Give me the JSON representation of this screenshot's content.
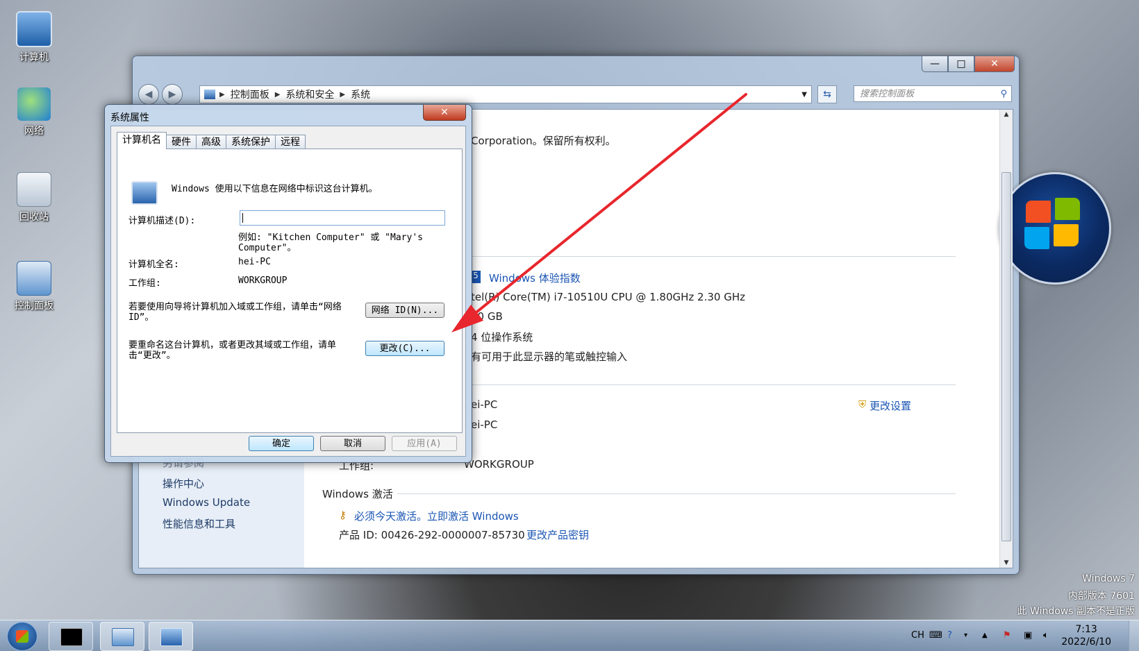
{
  "desktop": {
    "icons": [
      {
        "label": "计算机"
      },
      {
        "label": "网络"
      },
      {
        "label": "回收站"
      },
      {
        "label": "控制面板"
      }
    ]
  },
  "main_window": {
    "buttons": {
      "minimize": "—",
      "maximize": "□",
      "close": "✕"
    },
    "breadcrumb": [
      "控制面板",
      "系统和安全",
      "系统"
    ],
    "search_placeholder": "搜索控制面板",
    "left_pane": {
      "partial_heading": "另请参阅",
      "links": [
        "操作中心",
        "Windows Update",
        "性能信息和工具"
      ]
    },
    "copyright": "Corporation。保留所有权利。",
    "system": {
      "rating_link": "Windows 体验指数",
      "processor": "tel(R) Core(TM) i7-10510U CPU @ 1.80GHz   2.30 GHz",
      "memory": "00 GB",
      "type": "4 位操作系统",
      "pen": "有可用于此显示器的笔或触控输入"
    },
    "computer": {
      "name": "ei-PC",
      "full_name": "ei-PC",
      "workgroup_label": "工作组:",
      "workgroup": "WORKGROUP",
      "change_settings": "更改设置"
    },
    "activation": {
      "heading": "Windows 激活",
      "warning": "必须今天激活。立即激活 Windows",
      "product_id": "产品 ID: 00426-292-0000007-85730",
      "change_key": "更改产品密钥"
    }
  },
  "dialog": {
    "title": "系统属性",
    "close": "✕",
    "tabs": [
      "计算机名",
      "硬件",
      "高级",
      "系统保护",
      "远程"
    ],
    "intro": "Windows 使用以下信息在网络中标识这台计算机。",
    "description_label": "计算机描述(D):",
    "description_value": "",
    "example": "例如: \"Kitchen Computer\" 或 \"Mary's Computer\"。",
    "fullname_label": "计算机全名:",
    "fullname_value": "hei-PC",
    "workgroup_label": "工作组:",
    "workgroup_value": "WORKGROUP",
    "wizard_text": "若要使用向导将计算机加入域或工作组，请单击“网络 ID”。",
    "network_id_button": "网络 ID(N)...",
    "rename_text": "要重命名这台计算机，或者更改其域或工作组，请单击“更改”。",
    "change_button": "更改(C)...",
    "ok": "确定",
    "cancel": "取消",
    "apply": "应用(A)"
  },
  "watermark": {
    "line1": "Windows 7",
    "line2": "内部版本 7601",
    "line3": "此 Windows 副本不是正版"
  },
  "taskbar": {
    "lang": "CH",
    "time": "7:13",
    "date": "2022/6/10"
  },
  "colors": {
    "link": "#1a55b3",
    "arrow": "#e8262d"
  }
}
